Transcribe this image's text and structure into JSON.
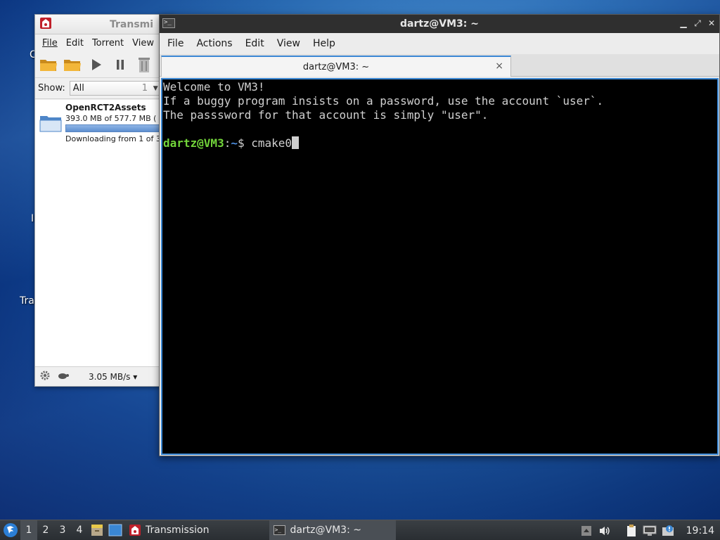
{
  "desktop": {
    "labels": [
      "C",
      "I",
      "Tra"
    ]
  },
  "transmission": {
    "title": "Transmission",
    "title_visible": "Transmi",
    "menu": {
      "file": "File",
      "edit": "Edit",
      "torrent": "Torrent",
      "view": "View"
    },
    "toolbar": {
      "icons": [
        "open-folder-icon",
        "open-folder-icon",
        "play-icon",
        "pause-icon",
        "trash-icon"
      ]
    },
    "filter": {
      "label": "Show:",
      "value": "All",
      "count": "1"
    },
    "torrents": [
      {
        "name": "OpenRCT2Assets",
        "size": "393.0 MB of 577.7 MB (",
        "progress": 0.68,
        "status": "Downloading from 1 of 3"
      }
    ],
    "statusbar": {
      "speed": "3.05 MB/s ▾"
    }
  },
  "terminal": {
    "title": "dartz@VM3: ~",
    "menu": {
      "file": "File",
      "actions": "Actions",
      "edit": "Edit",
      "view": "View",
      "help": "Help"
    },
    "tab": {
      "label": "dartz@VM3: ~",
      "close": "×"
    },
    "lines": [
      "Welcome to VM3!",
      "If a buggy program insists on a password, use the account `user`.",
      "The passsword for that account is simply \"user\".",
      ""
    ],
    "prompt": {
      "user_host": "dartz@VM3",
      "colon": ":",
      "path": "~",
      "symbol": "$ ",
      "command": "cmake0"
    }
  },
  "taskbar": {
    "workspaces": [
      "1",
      "2",
      "3",
      "4"
    ],
    "tasks": {
      "transmission": "Transmission",
      "terminal": "dartz@VM3: ~"
    },
    "clock": "19:14"
  },
  "colors": {
    "accent": "#3a87d4",
    "prompt_user": "#72d43a",
    "prompt_path": "#4d8fe0"
  }
}
